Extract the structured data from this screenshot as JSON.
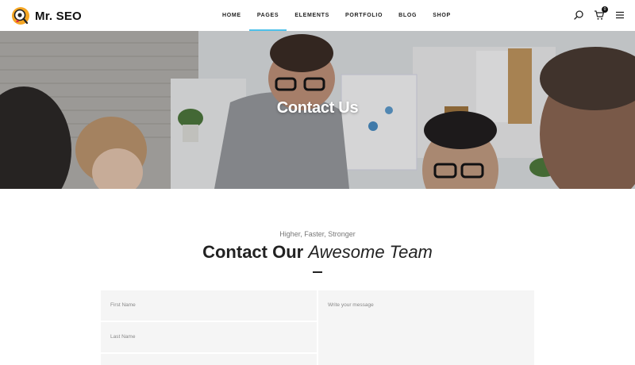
{
  "header": {
    "logo_text": "Mr. SEO",
    "nav": [
      {
        "label": "HOME",
        "active": false
      },
      {
        "label": "PAGES",
        "active": true
      },
      {
        "label": "ELEMENTS",
        "active": false
      },
      {
        "label": "PORTFOLIO",
        "active": false
      },
      {
        "label": "BLOG",
        "active": false
      },
      {
        "label": "SHOP",
        "active": false
      }
    ],
    "cart_count": "0",
    "icons": [
      "search-icon",
      "cart-icon",
      "menu-icon"
    ]
  },
  "hero": {
    "title": "Contact Us"
  },
  "section": {
    "subtitle": "Higher, Faster, Stronger",
    "title_bold": "Contact Our",
    "title_italic": "Awesome Team"
  },
  "form": {
    "first_name_placeholder": "First Name",
    "last_name_placeholder": "Last Name",
    "message_placeholder": "Write your message"
  },
  "colors": {
    "accent": "#4fc1e9",
    "logo_orange": "#f5a623",
    "field_bg": "#f5f5f5"
  }
}
